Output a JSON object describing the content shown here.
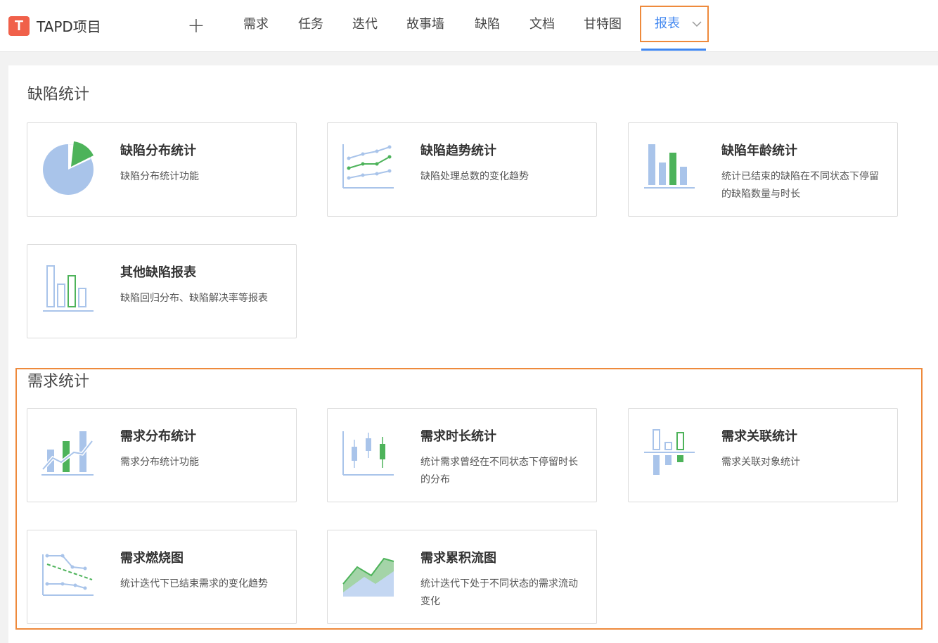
{
  "app": {
    "logo_letter": "T",
    "name": "TAPD项目"
  },
  "nav": {
    "add_symbol": "+",
    "items": [
      "需求",
      "任务",
      "迭代",
      "故事墙",
      "缺陷",
      "文档",
      "甘特图"
    ],
    "active": "报表"
  },
  "colors": {
    "accent": "#3f86f0",
    "highlight": "#ee8a3c",
    "brand": "#f0604a",
    "chart_blue": "#a9c4ea",
    "chart_green": "#4db35a"
  },
  "sections": [
    {
      "title": "缺陷统计",
      "cards": [
        {
          "icon": "pie-chart-icon",
          "title": "缺陷分布统计",
          "desc": "缺陷分布统计功能"
        },
        {
          "icon": "line-trend-icon",
          "title": "缺陷趋势统计",
          "desc": "缺陷处理总数的变化趋势"
        },
        {
          "icon": "bar-chart-icon",
          "title": "缺陷年龄统计",
          "desc": "统计已结束的缺陷在不同状态下停留的缺陷数量与时长"
        },
        {
          "icon": "outline-bar-icon",
          "title": "其他缺陷报表",
          "desc": "缺陷回归分布、缺陷解决率等报表"
        }
      ]
    },
    {
      "title": "需求统计",
      "cards": [
        {
          "icon": "bar-line-combo-icon",
          "title": "需求分布统计",
          "desc": "需求分布统计功能"
        },
        {
          "icon": "candlestick-icon",
          "title": "需求时长统计",
          "desc": "统计需求曾经在不同状态下停留时长的分布"
        },
        {
          "icon": "diverging-bar-icon",
          "title": "需求关联统计",
          "desc": "需求关联对象统计"
        },
        {
          "icon": "burndown-icon",
          "title": "需求燃烧图",
          "desc": "统计迭代下已结束需求的变化趋势"
        },
        {
          "icon": "area-flow-icon",
          "title": "需求累积流图",
          "desc": "统计迭代下处于不同状态的需求流动变化"
        }
      ]
    }
  ]
}
